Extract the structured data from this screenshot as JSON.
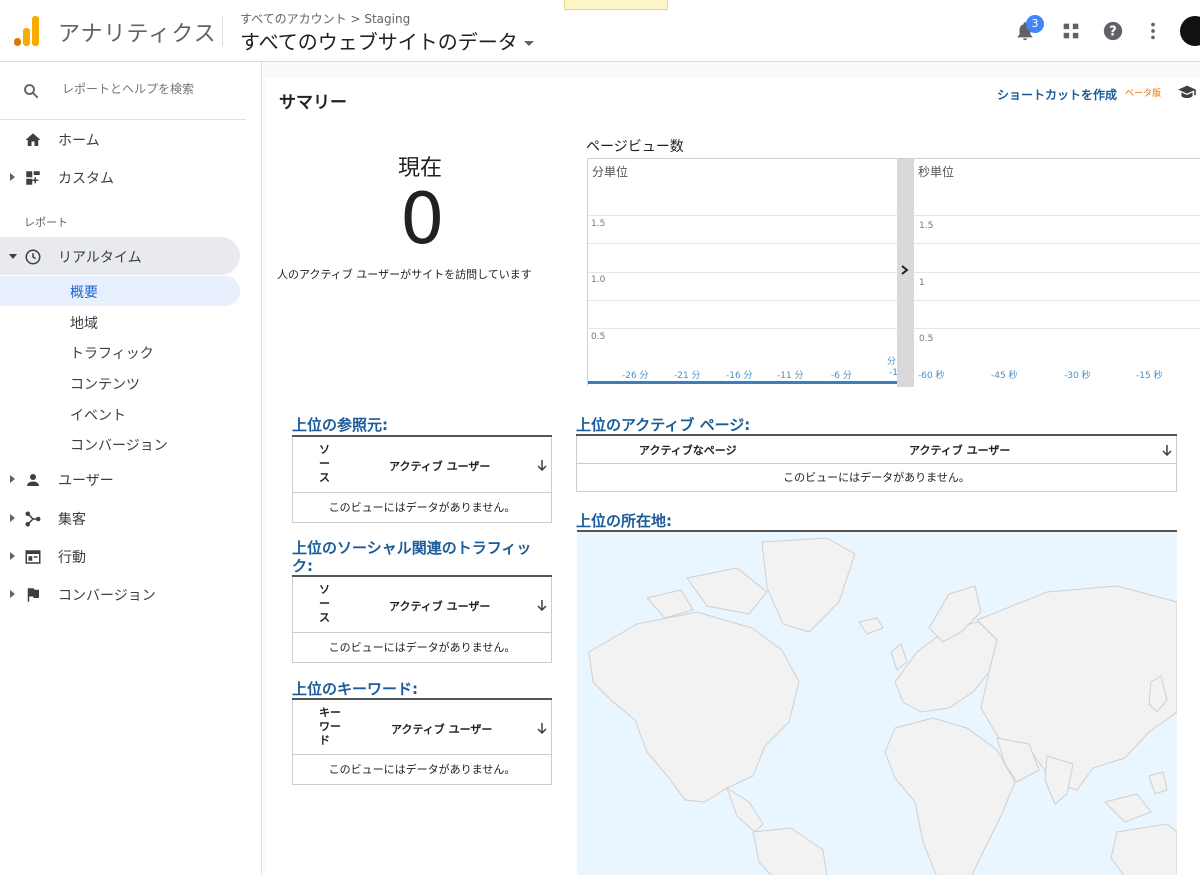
{
  "header": {
    "app_title": "アナリティクス",
    "breadcrumb": "すべてのアカウント > Staging",
    "property": "すべてのウェブサイトのデータ",
    "notification_count": "3",
    "logo_colors": [
      "#f9ab00",
      "#e37400"
    ]
  },
  "sidebar": {
    "search_placeholder": "レポートとヘルプを検索",
    "top_items": [
      {
        "label": "ホーム",
        "icon": "home-icon"
      },
      {
        "label": "カスタム",
        "icon": "dashboard-icon"
      }
    ],
    "reports_label": "レポート",
    "realtime_label": "リアルタイム",
    "realtime_subitems": [
      "概要",
      "地域",
      "トラフィック",
      "コンテンツ",
      "イベント",
      "コンバージョン"
    ],
    "bottom_items": [
      {
        "label": "ユーザー",
        "icon": "person-icon"
      },
      {
        "label": "集客",
        "icon": "acquisition-icon"
      },
      {
        "label": "行動",
        "icon": "behavior-icon"
      },
      {
        "label": "コンバージョン",
        "icon": "flag-icon"
      }
    ]
  },
  "main": {
    "title": "サマリー",
    "shortcut_label": "ショートカットを作成",
    "beta_label": "ベータ版",
    "now_label": "現在",
    "active_users": "0",
    "now_caption": "人のアクティブ ユーザーがサイトを訪問しています",
    "pageviews_title": "ページビュー数",
    "per_minute_label": "分単位",
    "per_second_label": "秒単位",
    "minute_y_ticks": [
      "1.5",
      "1.0",
      "0.5"
    ],
    "second_y_ticks": [
      "1.5",
      "1",
      "0.5"
    ],
    "minute_x_ticks": [
      "-26 分",
      "-21 分",
      "-16 分",
      "-11 分",
      "-6 分",
      "-1"
    ],
    "minute_unit_extra": "分",
    "second_x_ticks": [
      "-60 秒",
      "-45 秒",
      "-30 秒",
      "-15 秒"
    ],
    "referrers": {
      "title": "上位の参照元:",
      "col1": "ソース",
      "col2": "アクティブ ユーザー",
      "empty": "このビューにはデータがありません。"
    },
    "social": {
      "title": "上位のソーシャル関連のトラフィック:",
      "col1": "ソース",
      "col2": "アクティブ ユーザー",
      "empty": "このビューにはデータがありません。"
    },
    "keywords": {
      "title": "上位のキーワード:",
      "col1": "キーワード",
      "col2": "アクティブ ユーザー",
      "empty": "このビューにはデータがありません。"
    },
    "active_pages": {
      "title": "上位のアクティブ ページ:",
      "col1": "アクティブなページ",
      "col2": "アクティブ ユーザー",
      "empty": "このビューにはデータがありません。"
    },
    "locations": {
      "title": "上位の所在地:"
    }
  }
}
